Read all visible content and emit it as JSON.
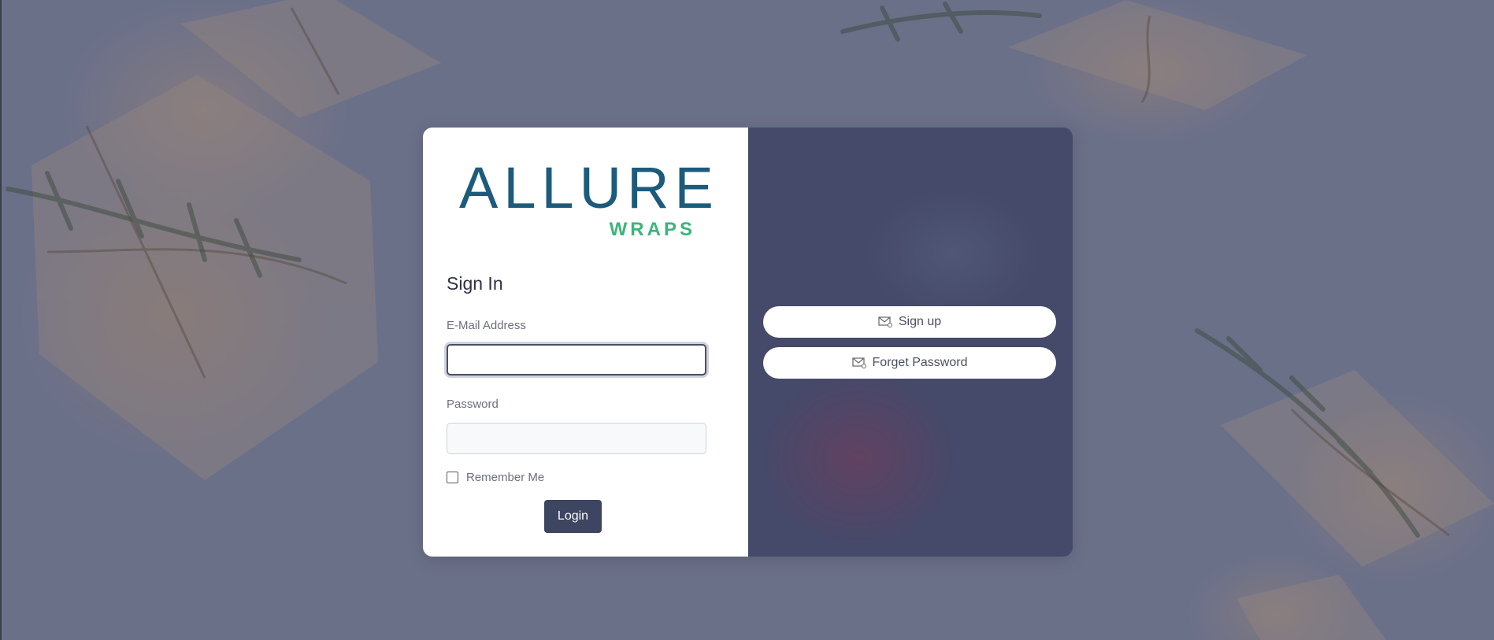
{
  "brand": {
    "name": "ALLURE",
    "tagline": "WRAPS"
  },
  "login_form": {
    "title": "Sign In",
    "email_label": "E-Mail Address",
    "email_value": "",
    "password_label": "Password",
    "password_value": "",
    "remember_label": "Remember Me",
    "remember_checked": false,
    "submit_label": "Login"
  },
  "side_actions": {
    "signup_label": "Sign up",
    "signup_icon": "envelope-icon",
    "forget_label": "Forget Password",
    "forget_icon": "envelope-icon"
  },
  "colors": {
    "brand_blue": "#1c5b7c",
    "brand_green": "#3bb57a",
    "button_dark": "#3d4560",
    "panel_dark": "#45496a",
    "overlay": "#6b7089"
  }
}
